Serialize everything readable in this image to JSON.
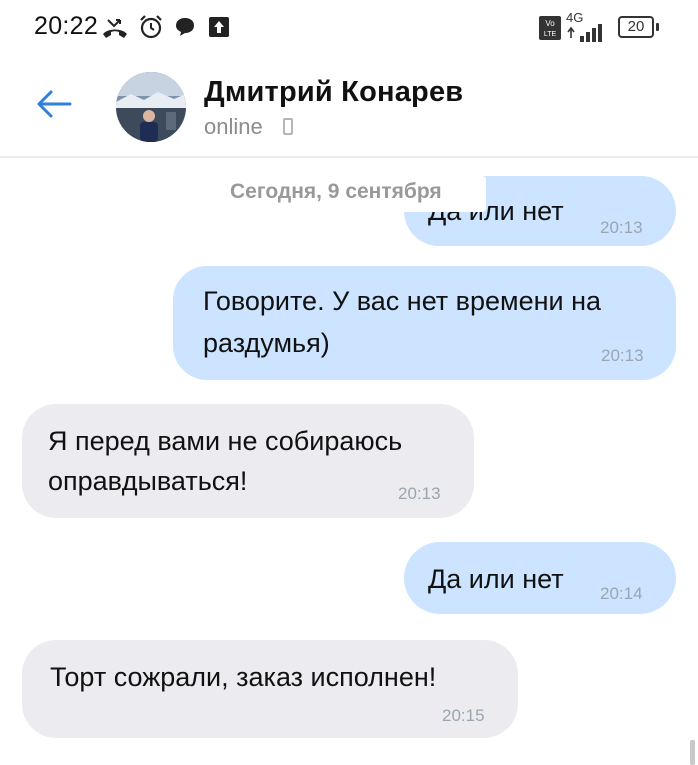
{
  "status_bar": {
    "time": "20:22",
    "icons_left": [
      "missed-call-icon",
      "alarm-icon",
      "chat-icon",
      "upload-icon"
    ],
    "network": "4G",
    "battery": "20"
  },
  "header": {
    "contact_name": "Дмитрий Конарев",
    "status": "online"
  },
  "chat": {
    "date_separator": "Сегодня, 9 сентября",
    "messages": [
      {
        "direction": "out",
        "text": "Да или нет",
        "time": "20:13"
      },
      {
        "direction": "out",
        "text_line1": "Говорите. У вас нет времени на",
        "text_line2": "раздумья)",
        "time": "20:13"
      },
      {
        "direction": "in",
        "text_line1": "Я перед вами не собираюсь",
        "text_line2": "оправдываться!",
        "time": "20:13"
      },
      {
        "direction": "out",
        "text": "Да или нет",
        "time": "20:14"
      },
      {
        "direction": "in",
        "text": "Торт сожрали, заказ исполнен!",
        "time": "20:15"
      }
    ]
  },
  "colors": {
    "outgoing_bubble": "#cce4ff",
    "incoming_bubble": "#ececf0",
    "accent": "#2f7fdc"
  }
}
